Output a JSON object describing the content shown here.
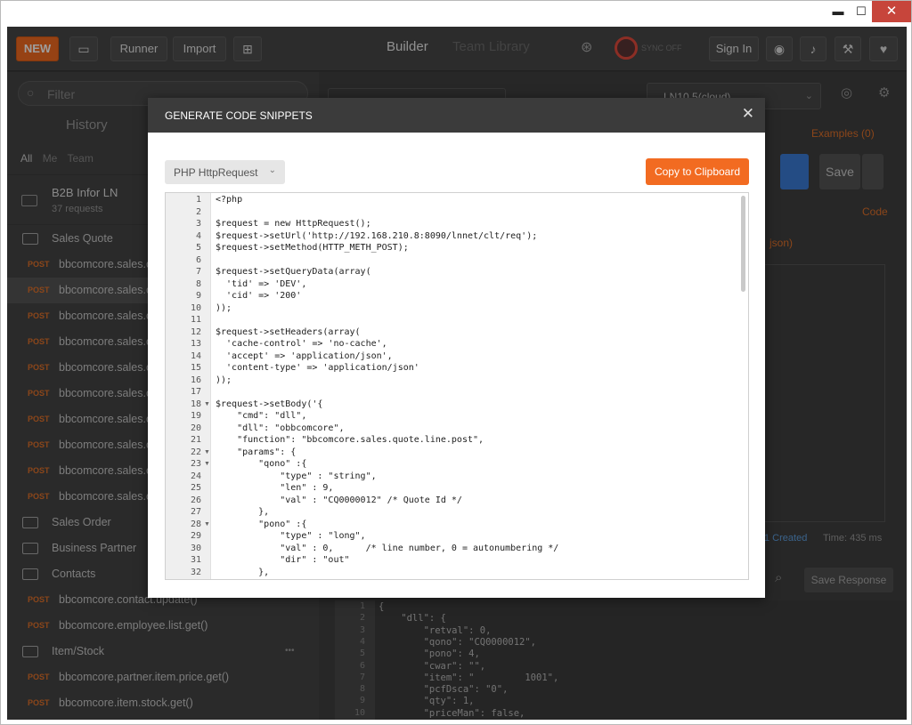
{
  "window": {
    "minimize": "▬",
    "maximize": "☐",
    "close": "✕"
  },
  "toolbar": {
    "new_label": "NEW",
    "runner_label": "Runner",
    "import_label": "Import",
    "tab_builder": "Builder",
    "tab_team_library": "Team Library",
    "sync_status": "SYNC OFF",
    "sign_in_label": "Sign In"
  },
  "sidebar": {
    "filter_placeholder": "Filter",
    "tab_history": "History",
    "filters": [
      "All",
      "Me",
      "Team"
    ],
    "collection": {
      "name": "B2B Infor LN",
      "count": "37 requests"
    },
    "rows": [
      {
        "type": "folder",
        "label": "Sales Quote"
      },
      {
        "type": "request",
        "method": "POST",
        "label": "bbcomcore.sales.c"
      },
      {
        "type": "request",
        "method": "POST",
        "label": "bbcomcore.sales.c",
        "selected": true
      },
      {
        "type": "request",
        "method": "POST",
        "label": "bbcomcore.sales.c"
      },
      {
        "type": "request",
        "method": "POST",
        "label": "bbcomcore.sales.c"
      },
      {
        "type": "request",
        "method": "POST",
        "label": "bbcomcore.sales.c"
      },
      {
        "type": "request",
        "method": "POST",
        "label": "bbcomcore.sales.c"
      },
      {
        "type": "request",
        "method": "POST",
        "label": "bbcomcore.sales.c"
      },
      {
        "type": "request",
        "method": "POST",
        "label": "bbcomcore.sales.c"
      },
      {
        "type": "request",
        "method": "POST",
        "label": "bbcomcore.sales.c"
      },
      {
        "type": "request",
        "method": "POST",
        "label": "bbcomcore.sales.c"
      },
      {
        "type": "folder",
        "label": "Sales Order"
      },
      {
        "type": "folder",
        "label": "Business Partner"
      },
      {
        "type": "folder",
        "label": "Contacts"
      },
      {
        "type": "request",
        "method": "POST",
        "label": "bbcomcore.contact.update()"
      },
      {
        "type": "request",
        "method": "POST",
        "label": "bbcomcore.employee.list.get()"
      },
      {
        "type": "folder",
        "label": "Item/Stock"
      },
      {
        "type": "request",
        "method": "POST",
        "label": "bbcomcore.partner.item.price.get()"
      },
      {
        "type": "request",
        "method": "POST",
        "label": "bbcomcore.item.stock.get()"
      }
    ]
  },
  "main": {
    "environment": "LN10.5(cloud)",
    "examples": "Examples (0)",
    "save_label": "Save",
    "code_link": "Code",
    "body_type": "json)",
    "status": "1 Created",
    "time": "Time: 435 ms",
    "save_response": "Save Response"
  },
  "modal": {
    "title": "GENERATE CODE SNIPPETS",
    "close": "✕",
    "language": "PHP HttpRequest",
    "copy_label": "Copy to Clipboard",
    "code_lines": [
      "<?php",
      "",
      "$request = new HttpRequest();",
      "$request->setUrl('http://192.168.210.8:8090/lnnet/clt/req');",
      "$request->setMethod(HTTP_METH_POST);",
      "",
      "$request->setQueryData(array(",
      "  'tid' => 'DEV',",
      "  'cid' => '200'",
      "));",
      "",
      "$request->setHeaders(array(",
      "  'cache-control' => 'no-cache',",
      "  'accept' => 'application/json',",
      "  'content-type' => 'application/json'",
      "));",
      "",
      "$request->setBody('{",
      "    \"cmd\": \"dll\",",
      "    \"dll\": \"obbcomcore\",",
      "    \"function\": \"bbcomcore.sales.quote.line.post\",",
      "    \"params\": {",
      "        \"qono\" :{",
      "            \"type\" : \"string\",",
      "            \"len\" : 9,",
      "            \"val\" : \"CQ0000012\" /* Quote Id */",
      "        },",
      "        \"pono\" :{",
      "            \"type\" : \"long\",",
      "            \"val\" : 0,      /* line number, 0 = autonumbering */",
      "            \"dir\" : \"out\"",
      "        },"
    ],
    "fold_lines": [
      18,
      22,
      23,
      28
    ]
  },
  "response": {
    "lines": [
      "{",
      "    \"dll\": {",
      "        \"retval\": 0,",
      "        \"qono\": \"CQ0000012\",",
      "        \"pono\": 4,",
      "        \"cwar\": \"\",",
      "        \"item\": \"         1001\",",
      "        \"pcfDsca\": \"0\",",
      "        \"qty\": 1,",
      "        \"priceMan\": false,"
    ]
  }
}
